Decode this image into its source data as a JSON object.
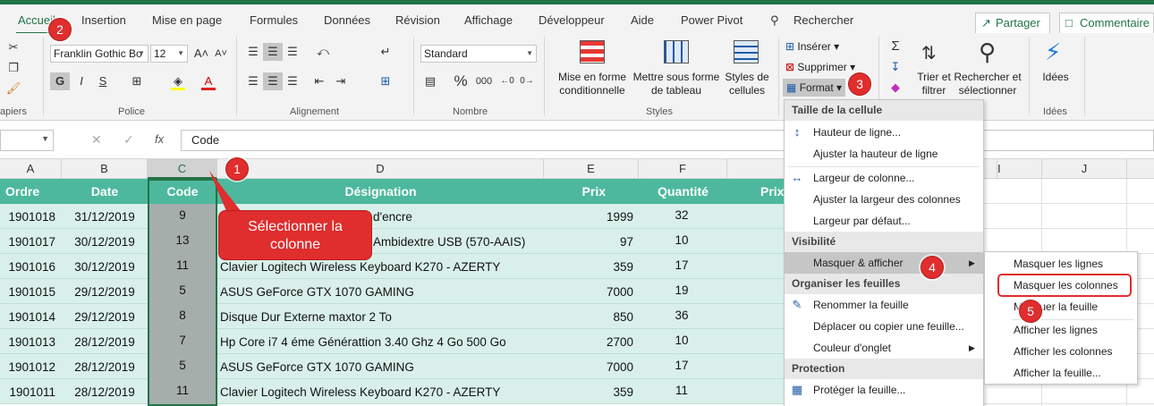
{
  "tabs": [
    "Accueil",
    "Insertion",
    "Mise en page",
    "Formules",
    "Données",
    "Révision",
    "Affichage",
    "Développeur",
    "Aide",
    "Power Pivot"
  ],
  "search_label": "Rechercher",
  "share_label": "Partager",
  "comments_label": "Commentaire",
  "ribbon": {
    "clipboard_label": "apiers",
    "font_name": "Franklin Gothic Bo",
    "font_size": "12",
    "font_group": "Police",
    "align_group": "Alignement",
    "number_format": "Standard",
    "number_group": "Nombre",
    "cond_format_l1": "Mise en forme",
    "cond_format_l2": "conditionnelle",
    "table_format_l1": "Mettre sous forme",
    "table_format_l2": "de tableau",
    "cell_styles_l1": "Styles de",
    "cell_styles_l2": "cellules",
    "styles_group": "Styles",
    "insert_label": "Insérer",
    "delete_label": "Supprimer",
    "format_label": "Format",
    "sort_l1": "Trier et",
    "sort_l2": "filtrer",
    "find_l1": "Rechercher et",
    "find_l2": "sélectionner",
    "ideas_label": "Idées",
    "ideas_group": "Idées",
    "bold": "G",
    "italic": "I",
    "underline": "S",
    "percent": "%"
  },
  "formula_bar": {
    "content": "Code",
    "fx": "fx"
  },
  "col_headers": [
    "A",
    "B",
    "C",
    "D",
    "E",
    "F",
    "",
    "",
    "I",
    "J"
  ],
  "header_row": [
    "Ordre",
    "Date",
    "Code",
    "Désignation",
    "Prix",
    "Quantité",
    "Prix"
  ],
  "rows": [
    {
      "ordre": "1901018",
      "date": "31/12/2019",
      "code": "9",
      "designation": "",
      "designation_tail": "d'encre",
      "prix": "1999",
      "qte": "32"
    },
    {
      "ordre": "1901017",
      "date": "30/12/2019",
      "code": "13",
      "designation": "",
      "designation_tail": "Ambidextre USB (570-AAIS)",
      "prix": "97",
      "qte": "10"
    },
    {
      "ordre": "1901016",
      "date": "30/12/2019",
      "code": "11",
      "designation": "Clavier Logitech Wireless Keyboard K270 - AZERTY",
      "designation_tail": "",
      "prix": "359",
      "qte": "17"
    },
    {
      "ordre": "1901015",
      "date": "29/12/2019",
      "code": "5",
      "designation": "ASUS GeForce GTX 1070 GAMING",
      "designation_tail": "",
      "prix": "7000",
      "qte": "19"
    },
    {
      "ordre": "1901014",
      "date": "29/12/2019",
      "code": "8",
      "designation": "Disque Dur Externe maxtor 2 To",
      "designation_tail": "",
      "prix": "850",
      "qte": "36"
    },
    {
      "ordre": "1901013",
      "date": "28/12/2019",
      "code": "7",
      "designation": "Hp Core i7 4 éme Générattion 3.40 Ghz 4 Go 500 Go",
      "designation_tail": "",
      "prix": "2700",
      "qte": "10"
    },
    {
      "ordre": "1901012",
      "date": "28/12/2019",
      "code": "5",
      "designation": "ASUS GeForce GTX 1070 GAMING",
      "designation_tail": "",
      "prix": "7000",
      "qte": "17"
    },
    {
      "ordre": "1901011",
      "date": "28/12/2019",
      "code": "11",
      "designation": "Clavier Logitech Wireless Keyboard K270 - AZERTY",
      "designation_tail": "",
      "prix": "359",
      "qte": "11"
    }
  ],
  "callout": {
    "line1": "Sélectionner la",
    "line2": "colonne"
  },
  "badges": [
    "1",
    "2",
    "3",
    "4",
    "5"
  ],
  "format_menu": {
    "sec_size": "Taille de la cellule",
    "row_height": "Hauteur de ligne...",
    "autofit_row": "Ajuster la hauteur de ligne",
    "col_width": "Largeur de colonne...",
    "autofit_col": "Ajuster la largeur des colonnes",
    "default_width": "Largeur par défaut...",
    "sec_visibility": "Visibilité",
    "hide_show": "Masquer & afficher",
    "sec_organize": "Organiser les feuilles",
    "rename": "Renommer la feuille",
    "move_copy": "Déplacer ou copier une feuille...",
    "tab_color": "Couleur d'onglet",
    "sec_protect": "Protection",
    "protect": "Protéger la feuille..."
  },
  "submenu": {
    "hide_rows": "Masquer les lignes",
    "hide_cols": "Masquer les colonnes",
    "hide_sheet": "Masquer la feuille",
    "show_rows": "Afficher les lignes",
    "show_cols": "Afficher les colonnes",
    "show_sheet": "Afficher la feuille..."
  },
  "colors": {
    "excel_green": "#217346",
    "header_teal": "#4db89d",
    "row_fill": "#d9f0ea",
    "badge_red": "#e02d2d"
  }
}
